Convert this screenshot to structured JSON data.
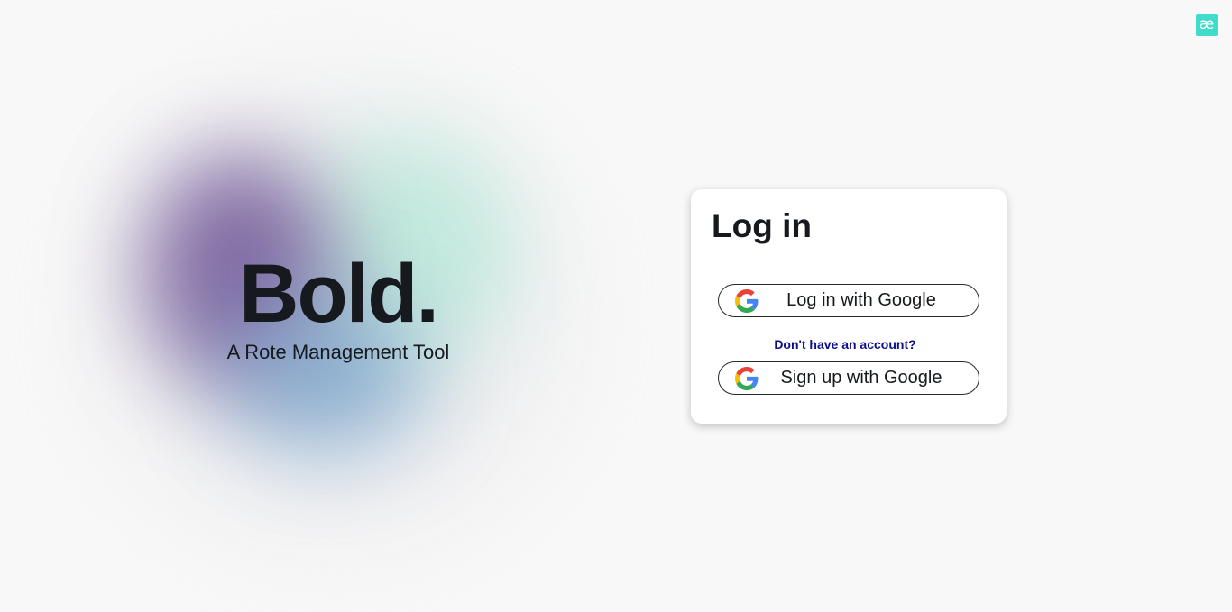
{
  "corner_logo": {
    "glyph": "æ",
    "color": "#3fdccb"
  },
  "brand": {
    "title": "Bold.",
    "subtitle": "A Rote Management Tool"
  },
  "login_card": {
    "title": "Log in",
    "login_button_label": "Log in with Google",
    "signup_prompt": "Don't have an account?",
    "signup_button_label": "Sign up with Google",
    "button_icon": "google-logo-icon"
  },
  "colors": {
    "background": "#f8f8f8",
    "text": "#16191d",
    "link": "#0d0d8a",
    "accent": "#3fdccb"
  }
}
